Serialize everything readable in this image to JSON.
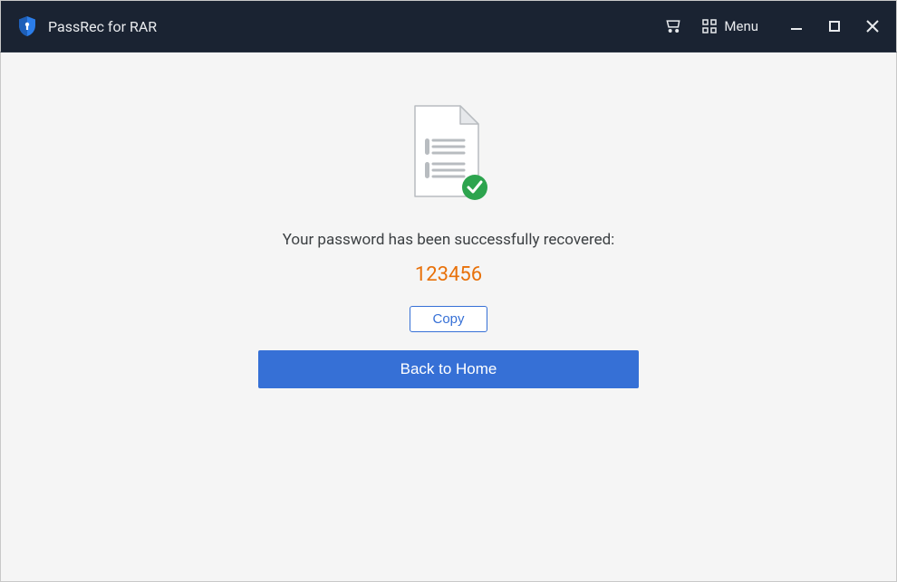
{
  "titlebar": {
    "app_name": "PassRec for RAR",
    "menu_label": "Menu"
  },
  "main": {
    "success_message": "Your password has been successfully recovered:",
    "password": "123456",
    "copy_label": "Copy",
    "home_label": "Back to Home"
  }
}
